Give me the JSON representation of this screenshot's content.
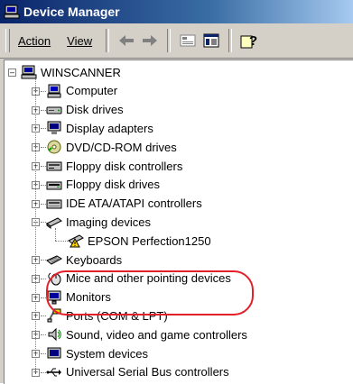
{
  "window": {
    "title": "Device Manager"
  },
  "toolbar": {
    "menu_action": "Action",
    "menu_view": "View",
    "buttons": [
      "back-arrow-icon",
      "forward-arrow-icon",
      "properties-icon",
      "console-tree-icon",
      "help-icon"
    ]
  },
  "tree": {
    "root": "WINSCANNER",
    "items": [
      {
        "label": "Computer",
        "icon": "computer-icon",
        "expander": "+"
      },
      {
        "label": "Disk drives",
        "icon": "disk-drive-icon",
        "expander": "+"
      },
      {
        "label": "Display adapters",
        "icon": "display-adapter-icon",
        "expander": "+"
      },
      {
        "label": "DVD/CD-ROM drives",
        "icon": "dvd-drive-icon",
        "expander": "+"
      },
      {
        "label": "Floppy disk controllers",
        "icon": "floppy-controller-icon",
        "expander": "+"
      },
      {
        "label": "Floppy disk drives",
        "icon": "floppy-drive-icon",
        "expander": "+"
      },
      {
        "label": "IDE ATA/ATAPI controllers",
        "icon": "ide-controller-icon",
        "expander": "+"
      },
      {
        "label": "Imaging devices",
        "icon": "scanner-icon",
        "expander": "−",
        "children": [
          {
            "label": "EPSON Perfection1250",
            "icon": "scanner-warning-icon"
          }
        ]
      },
      {
        "label": "Keyboards",
        "icon": "keyboard-icon",
        "expander": "+"
      },
      {
        "label": "Mice and other pointing devices",
        "icon": "mouse-icon",
        "expander": "+"
      },
      {
        "label": "Monitors",
        "icon": "monitor-icon",
        "expander": "+"
      },
      {
        "label": "Ports (COM & LPT)",
        "icon": "port-icon",
        "expander": "+"
      },
      {
        "label": "Sound, video and game controllers",
        "icon": "sound-icon",
        "expander": "+"
      },
      {
        "label": "System devices",
        "icon": "system-device-icon",
        "expander": "+"
      },
      {
        "label": "Universal Serial Bus controllers",
        "icon": "usb-icon",
        "expander": "+"
      }
    ]
  },
  "colors": {
    "highlight": "#e3202a",
    "titlebar": "#0a246a",
    "warning": "#ffd700"
  }
}
